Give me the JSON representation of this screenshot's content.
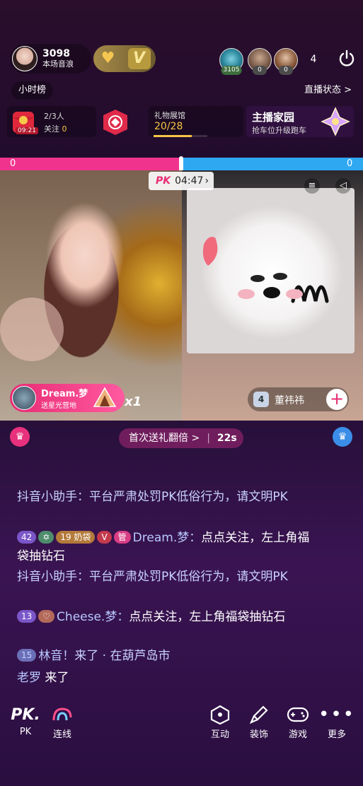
{
  "header": {
    "host_score": "3098",
    "host_sub": "本场音浪",
    "viewers": [
      {
        "badge": "3105"
      },
      {
        "badge": "0"
      },
      {
        "badge": "0"
      }
    ],
    "viewer_count": "4",
    "hour_rank": "小时榜",
    "live_status": "直播状态 >"
  },
  "cards": {
    "redbag_time": "09:21",
    "fans_progress": "2/3人",
    "follow_label": "关注",
    "follow_count": "0",
    "gift_hall_title": "礼物展馆",
    "gift_hall_progress": "20/28",
    "gift_hall_fraction": 0.71,
    "host_home_title": "主播家园",
    "host_home_sub": "抢车位升级跑车"
  },
  "pk": {
    "left_score": "0",
    "right_score": "0",
    "logo": "PK",
    "timer": "04:47",
    "left_gifter": "Dream.梦",
    "left_gifter_sub": "送星光营地",
    "left_gift_count": "x1",
    "right_guest": "董祎祎",
    "right_level": "4",
    "first_gift_banner": "首次送礼翻倍 >",
    "first_gift_time": "22s"
  },
  "chat": [
    {
      "name": "抖音小助手：",
      "text": "平台严肃处罚PK低俗行为，请文明PK"
    },
    {
      "badges": [
        "42",
        "✡",
        "19 奶袋",
        "V",
        "管"
      ],
      "name": "Dream.梦：",
      "text": "点点关注，左上角福袋抽钻石"
    },
    {
      "name": "抖音小助手：",
      "text": "平台严肃处罚PK低俗行为，请文明PK"
    },
    {
      "badges": [
        "13",
        "♡"
      ],
      "name": "Cheese.梦：",
      "text": "点点关注，左上角福袋抽钻石"
    },
    {
      "badges": [
        "15"
      ],
      "name": "林音！",
      "text": "来了 · 在葫芦岛市"
    },
    {
      "name": "老罗",
      "text": "来了"
    }
  ],
  "bottom_bar": {
    "pk_label": "PK",
    "link_label": "连线",
    "interact_label": "互动",
    "decor_label": "装饰",
    "game_label": "游戏",
    "more_label": "更多"
  },
  "colors": {
    "pk_pink": "#f0348d",
    "pk_blue": "#2fa8f2",
    "gold": "#f5c544"
  }
}
